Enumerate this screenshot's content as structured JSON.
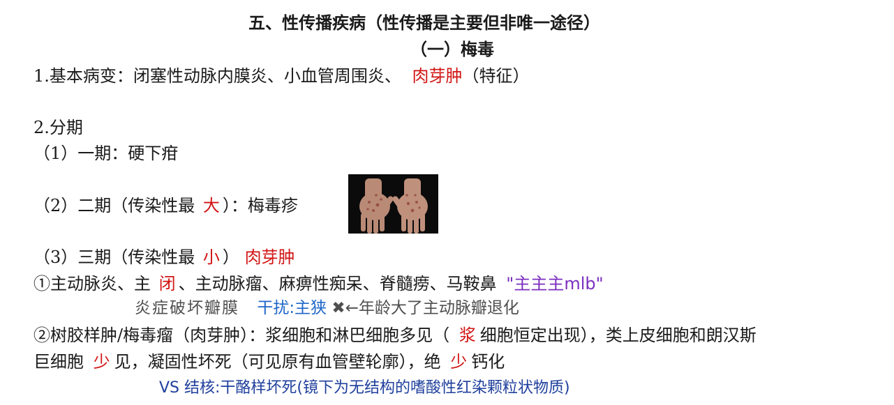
{
  "heading": {
    "title": "五、性传播疾病（性传播是主要但非唯一途径）",
    "subtitle": "（一）梅毒"
  },
  "pathology": {
    "text": "1.基本病变：闭塞性动脉内膜炎、小血管周围炎、",
    "highlight": "肉芽肿",
    "suffix": "（特征）"
  },
  "staging": {
    "title": "2.分期",
    "stage1": "（1）一期：硬下疳",
    "stage2": {
      "prefix": "（2）二期（传染性最",
      "highlight": "大",
      "suffix": "）：梅毒疹"
    },
    "stage3": {
      "prefix": "（3）三期（传染性最",
      "highlight": "小",
      "suffix": "）",
      "note": "肉芽肿"
    }
  },
  "item1": {
    "prefix": "①主动脉炎、主",
    "highlight": "闭",
    "suffix": "、主动脉瘤、麻痹性痴呆、脊髓痨、马鞍鼻",
    "note": "\"主主主mlb\""
  },
  "note_line": {
    "part1": "炎症破坏瓣膜",
    "part2": "干扰:主狭",
    "part3": "←年龄大了主动脉瓣退化"
  },
  "item2": {
    "line1_prefix": "②树胶样肿/梅毒瘤（肉芽肿）：浆细胞和淋巴细胞多见（",
    "line1_highlight": "浆",
    "line1_suffix": "细胞恒定出现），类上皮细胞和朗汉斯",
    "line2_prefix": "巨细胞",
    "line2_highlight1": "少",
    "line2_middle": "见，凝固性坏死（可见原有血管壁轮廓），绝",
    "line2_highlight2": "少",
    "line2_suffix": "钙化"
  },
  "vs_note": "VS  结核:干酪样坏死(镜下为无结构的嗜酸性红染颗粒状物质)",
  "colors": {
    "red": "#d21414",
    "blue": "#1e66c8",
    "navy": "#1f3f9c",
    "purple": "#7b2fbf",
    "gray": "#4f4f4f"
  }
}
